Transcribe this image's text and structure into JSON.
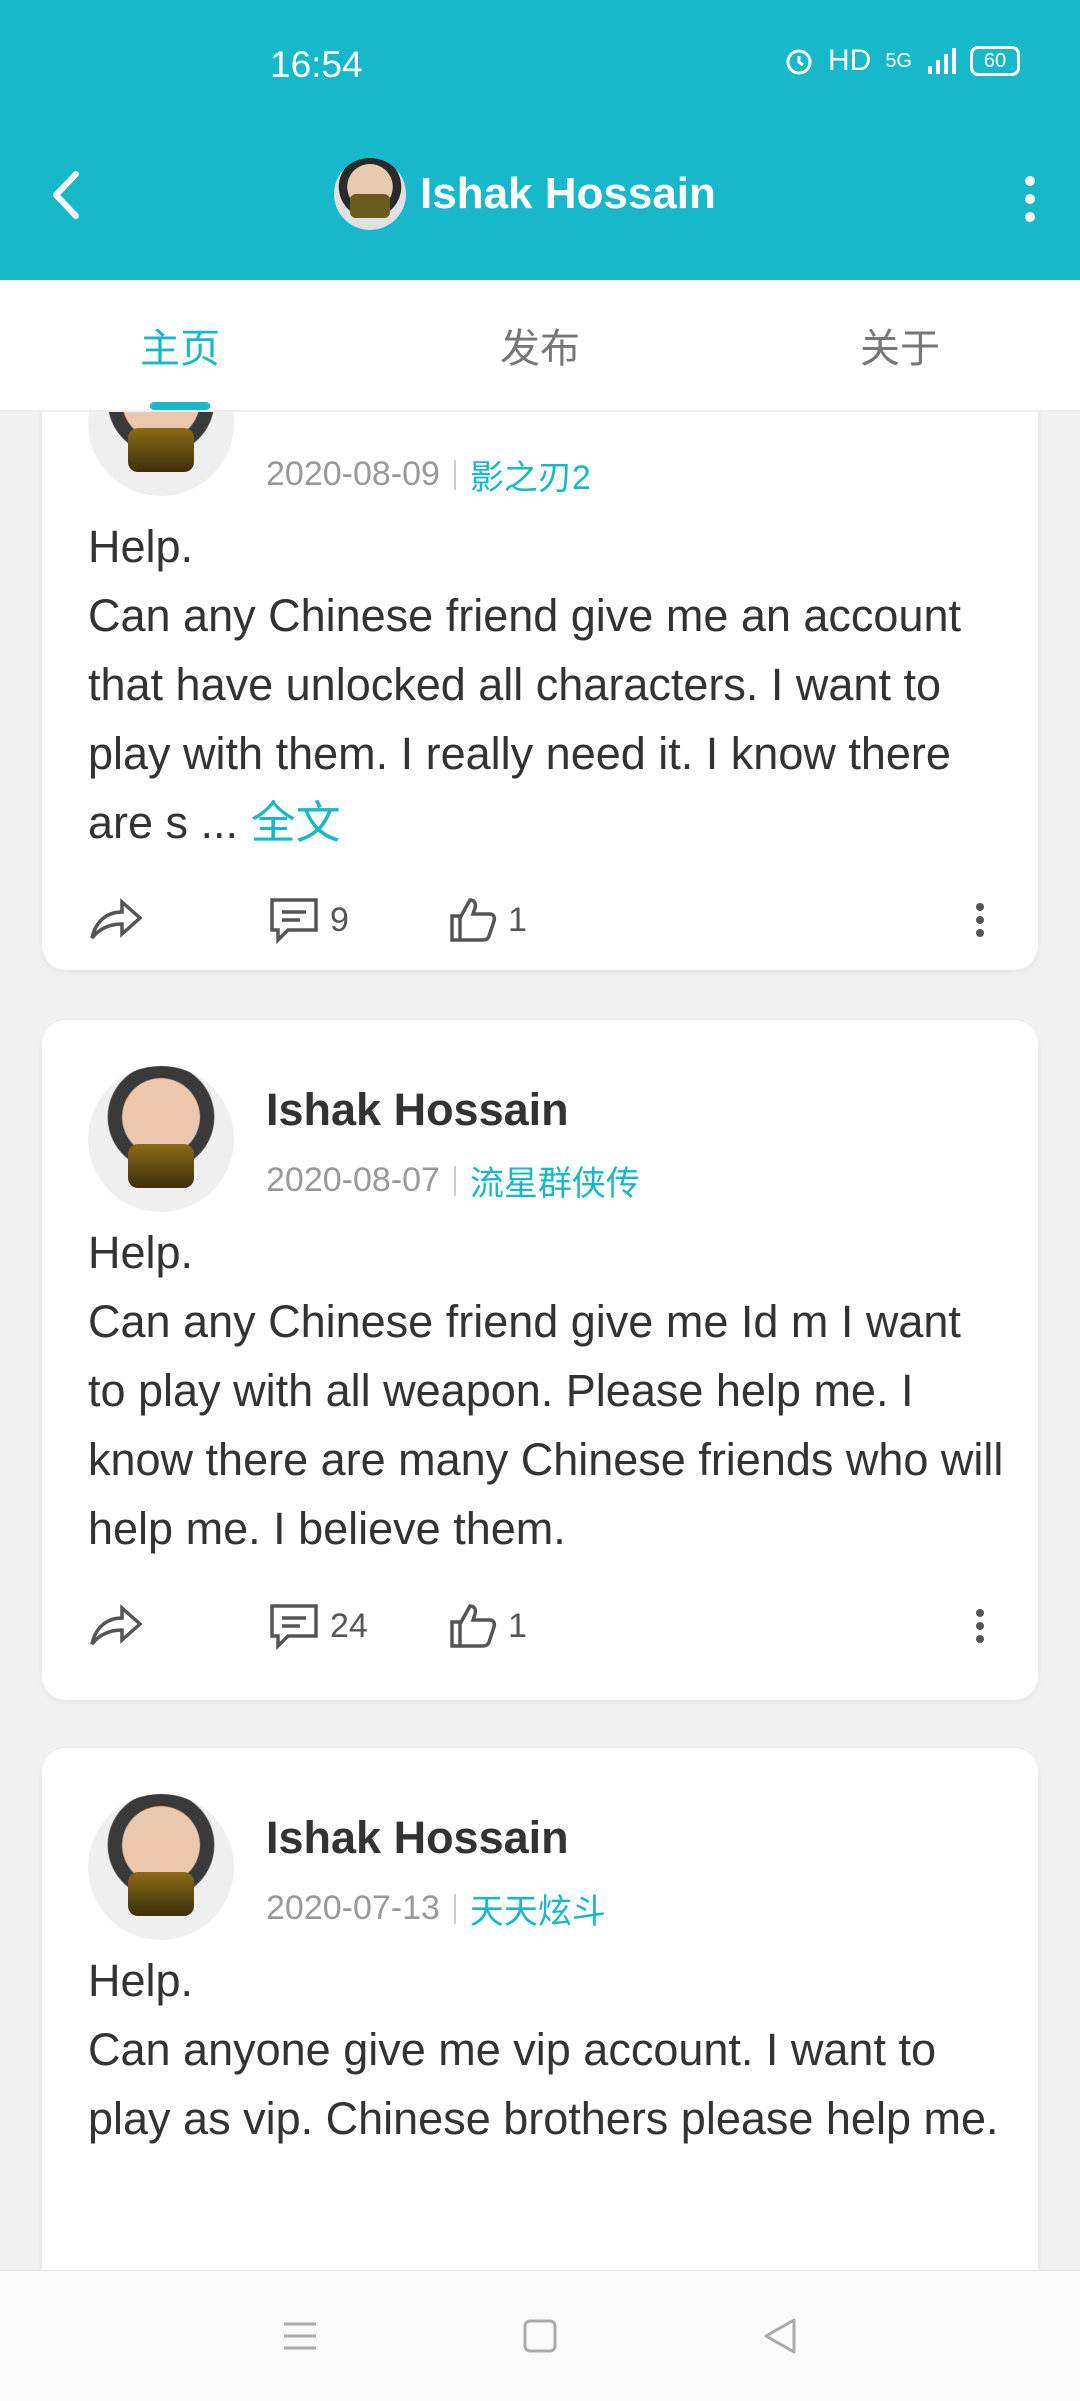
{
  "status": {
    "time": "16:54",
    "hd": "HD",
    "network": "5G",
    "battery": "60"
  },
  "header": {
    "title": "Ishak Hossain"
  },
  "tabs": [
    {
      "label": "主页",
      "active": true
    },
    {
      "label": "发布",
      "active": false
    },
    {
      "label": "关于",
      "active": false
    }
  ],
  "posts": [
    {
      "author": "",
      "date": "2020-08-09",
      "game": "影之刃2",
      "text": "Help.\nCan any Chinese friend give me an account that have unlocked all characters.  I want to play with them. I really need it. I know there are s ...",
      "full_text_link": "全文",
      "comments": "9",
      "likes": "1"
    },
    {
      "author": "Ishak Hossain",
      "date": "2020-08-07",
      "game": "流星群侠传",
      "text": "Help.\nCan any Chinese friend give me Id m I want to play with all weapon.  Please help me. I know there are many Chinese friends who will help me. I believe them.",
      "comments": "24",
      "likes": "1"
    },
    {
      "author": "Ishak Hossain",
      "date": "2020-07-13",
      "game": "天天炫斗",
      "text": "Help.\nCan anyone give me vip account.  I want to play as vip. Chinese brothers please help me."
    }
  ],
  "colors": {
    "accent": "#17b8c9",
    "header_bg": "#17b8c9"
  },
  "icons": [
    "back-arrow-icon",
    "more-vertical-icon",
    "share-icon",
    "comment-icon",
    "thumbs-up-icon",
    "menu-icon",
    "home-square-icon",
    "back-triangle-icon",
    "alarm-icon",
    "signal-icon",
    "battery-icon"
  ]
}
